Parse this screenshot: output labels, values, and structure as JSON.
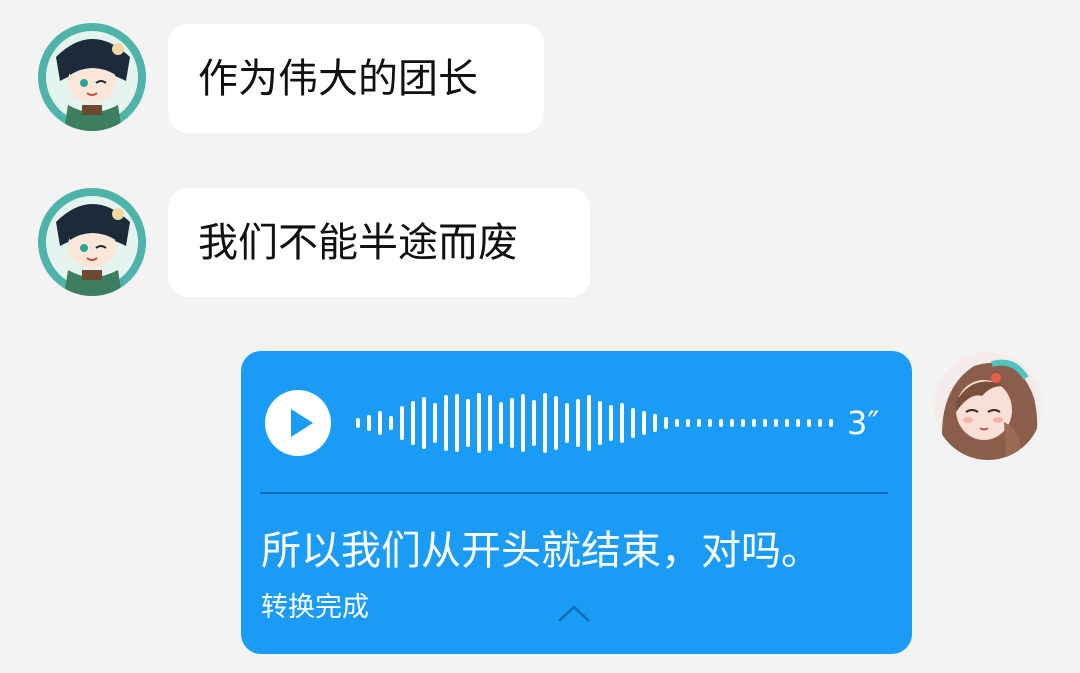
{
  "messages": [
    {
      "sender": "other",
      "avatar_icon": "venti-avatar-icon",
      "text": "作为伟大的团长"
    },
    {
      "sender": "other",
      "avatar_icon": "venti-avatar-icon",
      "text": "我们不能半途而废"
    }
  ],
  "voice_message": {
    "sender": "self",
    "avatar_icon": "girl-avatar-icon",
    "duration": "3″",
    "transcript": "所以我们从开头就结束，对吗。",
    "status": "转换完成",
    "play_icon": "play-icon",
    "collapse_icon": "chevron-up-icon",
    "bubble_color": "#1a9cf6"
  },
  "colors": {
    "background": "#f3f3f3",
    "bubble_other": "#ffffff",
    "bubble_self": "#1a9cf6"
  }
}
